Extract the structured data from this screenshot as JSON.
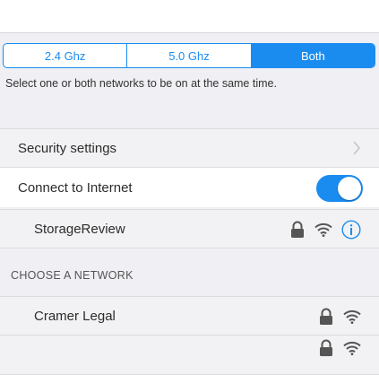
{
  "band_selector": {
    "options": [
      "2.4 Ghz",
      "5.0 Ghz",
      "Both"
    ],
    "selected": "Both"
  },
  "hint_text": "Select one or both networks to be on at the same time.",
  "security_settings": {
    "label": "Security settings"
  },
  "connect_internet": {
    "label": "Connect to Internet",
    "enabled": true
  },
  "current_network": {
    "name": "StorageReview",
    "icons": [
      "lock-icon",
      "wifi-icon",
      "info-icon"
    ]
  },
  "choose_network": {
    "header": "CHOOSE A NETWORK",
    "networks": [
      {
        "name": "Cramer Legal",
        "icons": [
          "lock-icon",
          "wifi-icon"
        ]
      },
      {
        "name": "",
        "icons": [
          "lock-icon",
          "wifi-icon"
        ]
      }
    ]
  },
  "colors": {
    "accent": "#1a8cf0",
    "background": "#efeff4"
  }
}
